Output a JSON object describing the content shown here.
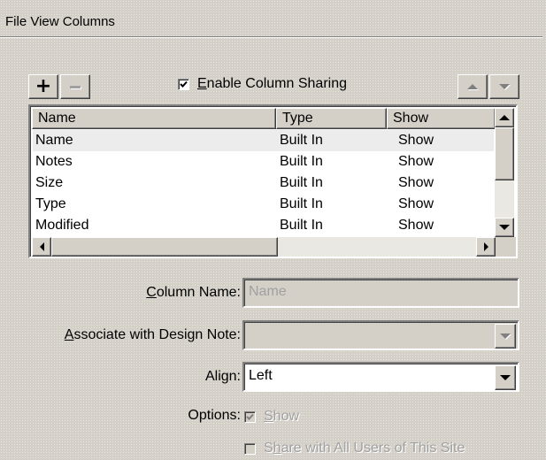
{
  "panel": {
    "title": "File View Columns"
  },
  "toolbar": {
    "add_label": "+",
    "enable_sharing": {
      "label": "Enable Column Sharing",
      "mnemonic": "E",
      "rest": "nable Column Sharing",
      "checked": true
    }
  },
  "table": {
    "columns": [
      "Name",
      "Type",
      "Show"
    ],
    "rows": [
      {
        "name": "Name",
        "type": "Built In",
        "show": "Show",
        "selected": true
      },
      {
        "name": "Notes",
        "type": "Built In",
        "show": "Show",
        "selected": false
      },
      {
        "name": "Size",
        "type": "Built In",
        "show": "Show",
        "selected": false
      },
      {
        "name": "Type",
        "type": "Built In",
        "show": "Show",
        "selected": false
      },
      {
        "name": "Modified",
        "type": "Built In",
        "show": "Show",
        "selected": false
      }
    ]
  },
  "form": {
    "column_name": {
      "mnemonic": "C",
      "rest": "olumn Name:",
      "value": "Name"
    },
    "associate": {
      "mnemonic": "A",
      "rest": "ssociate with Design Note:",
      "value": ""
    },
    "align": {
      "label_pre": "Ali",
      "mnemonic": "g",
      "label_post": "n:",
      "value": "Left"
    },
    "options": {
      "label": "Options:",
      "show": {
        "mnemonic": "S",
        "rest": "how",
        "checked": true,
        "disabled": true
      },
      "share": {
        "pre": "S",
        "mnemonic": "h",
        "rest": "are with All Users of This Site",
        "checked": false
      }
    }
  }
}
